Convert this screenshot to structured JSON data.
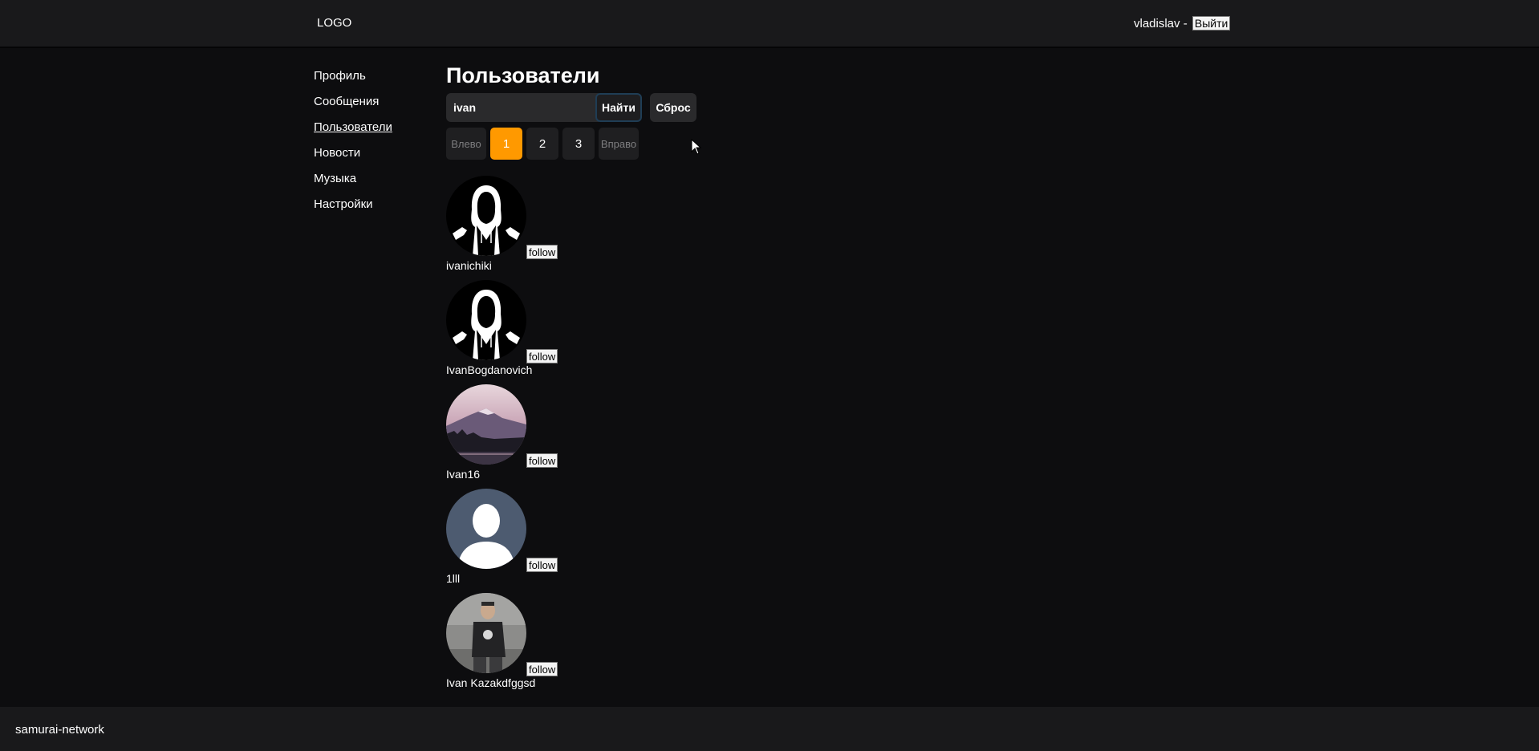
{
  "header": {
    "logo": "LOGO",
    "username": "vladislav",
    "separator": " - ",
    "logout_label": "Выйти"
  },
  "sidebar": {
    "items": [
      {
        "label": "Профиль"
      },
      {
        "label": "Сообщения"
      },
      {
        "label": "Пользователи",
        "active": true
      },
      {
        "label": "Новости"
      },
      {
        "label": "Музыка"
      },
      {
        "label": "Настройки"
      }
    ]
  },
  "main": {
    "title": "Пользователи",
    "search": {
      "value": "ivan",
      "find_label": "Найти",
      "reset_label": "Сброс"
    },
    "pagination": {
      "prev_label": "Влево",
      "pages": [
        "1",
        "2",
        "3"
      ],
      "current": "1",
      "next_label": "Вправо"
    },
    "users": [
      {
        "name": "ivanichiki",
        "avatar": "hooded-figure-avatar",
        "follow_label": "follow"
      },
      {
        "name": "IvanBogdanovich",
        "avatar": "hooded-figure-avatar",
        "follow_label": "follow"
      },
      {
        "name": "Ivan16",
        "avatar": "mountain-landscape-avatar",
        "follow_label": "follow"
      },
      {
        "name": "1lll",
        "avatar": "default-user-silhouette-avatar",
        "follow_label": "follow"
      },
      {
        "name": "Ivan Kazakdfggsd",
        "avatar": "person-photo-avatar",
        "follow_label": "follow"
      }
    ]
  },
  "footer": {
    "text": "samurai-network"
  },
  "colors": {
    "background": "#0d0d0f",
    "header_bg": "#19191b",
    "accent_active_page": "#ff9900"
  }
}
